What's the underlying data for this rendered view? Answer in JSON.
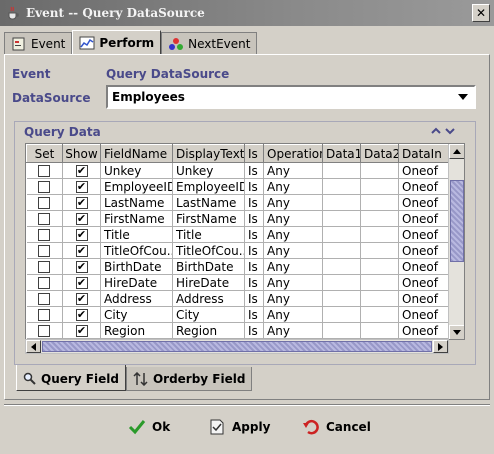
{
  "window": {
    "title": "Event -- Query DataSource"
  },
  "tabs_top": [
    {
      "label": "Event",
      "icon": "event-icon",
      "active": false
    },
    {
      "label": "Perform",
      "icon": "chart-icon",
      "active": true
    },
    {
      "label": "NextEvent",
      "icon": "colored-dots-icon",
      "active": false
    }
  ],
  "form": {
    "event_label": "Event",
    "event_value": "Query DataSource",
    "datasource_label": "DataSource",
    "datasource_value": "Employees"
  },
  "query_data": {
    "title": "Query Data",
    "columns": [
      "Set",
      "Show",
      "FieldName",
      "DisplayText",
      "Is",
      "Operation",
      "Data1",
      "Data2",
      "DataIn"
    ],
    "rows": [
      {
        "set": false,
        "show": true,
        "field": "Unkey",
        "display": "Unkey",
        "is": "Is",
        "op": "Any",
        "d1": "",
        "d2": "",
        "din": "Oneof"
      },
      {
        "set": false,
        "show": true,
        "field": "EmployeeID",
        "display": "EmployeeID",
        "is": "Is",
        "op": "Any",
        "d1": "",
        "d2": "",
        "din": "Oneof"
      },
      {
        "set": false,
        "show": true,
        "field": "LastName",
        "display": "LastName",
        "is": "Is",
        "op": "Any",
        "d1": "",
        "d2": "",
        "din": "Oneof"
      },
      {
        "set": false,
        "show": true,
        "field": "FirstName",
        "display": "FirstName",
        "is": "Is",
        "op": "Any",
        "d1": "",
        "d2": "",
        "din": "Oneof"
      },
      {
        "set": false,
        "show": true,
        "field": "Title",
        "display": "Title",
        "is": "Is",
        "op": "Any",
        "d1": "",
        "d2": "",
        "din": "Oneof"
      },
      {
        "set": false,
        "show": true,
        "field": "TitleOfCou...",
        "display": "TitleOfCou...",
        "is": "Is",
        "op": "Any",
        "d1": "",
        "d2": "",
        "din": "Oneof"
      },
      {
        "set": false,
        "show": true,
        "field": "BirthDate",
        "display": "BirthDate",
        "is": "Is",
        "op": "Any",
        "d1": "",
        "d2": "",
        "din": "Oneof"
      },
      {
        "set": false,
        "show": true,
        "field": "HireDate",
        "display": "HireDate",
        "is": "Is",
        "op": "Any",
        "d1": "",
        "d2": "",
        "din": "Oneof"
      },
      {
        "set": false,
        "show": true,
        "field": "Address",
        "display": "Address",
        "is": "Is",
        "op": "Any",
        "d1": "",
        "d2": "",
        "din": "Oneof"
      },
      {
        "set": false,
        "show": true,
        "field": "City",
        "display": "City",
        "is": "Is",
        "op": "Any",
        "d1": "",
        "d2": "",
        "din": "Oneof"
      },
      {
        "set": false,
        "show": true,
        "field": "Region",
        "display": "Region",
        "is": "Is",
        "op": "Any",
        "d1": "",
        "d2": "",
        "din": "Oneof"
      }
    ]
  },
  "tabs_bottom": [
    {
      "label": "Query Field",
      "icon": "magnifier-icon",
      "active": true
    },
    {
      "label": "Orderby Field",
      "icon": "sort-arrows-icon",
      "active": false
    }
  ],
  "buttons": {
    "ok": "Ok",
    "apply": "Apply",
    "cancel": "Cancel"
  },
  "colors": {
    "label": "#4a4a8a",
    "scroll_thumb": "#9898c8"
  }
}
